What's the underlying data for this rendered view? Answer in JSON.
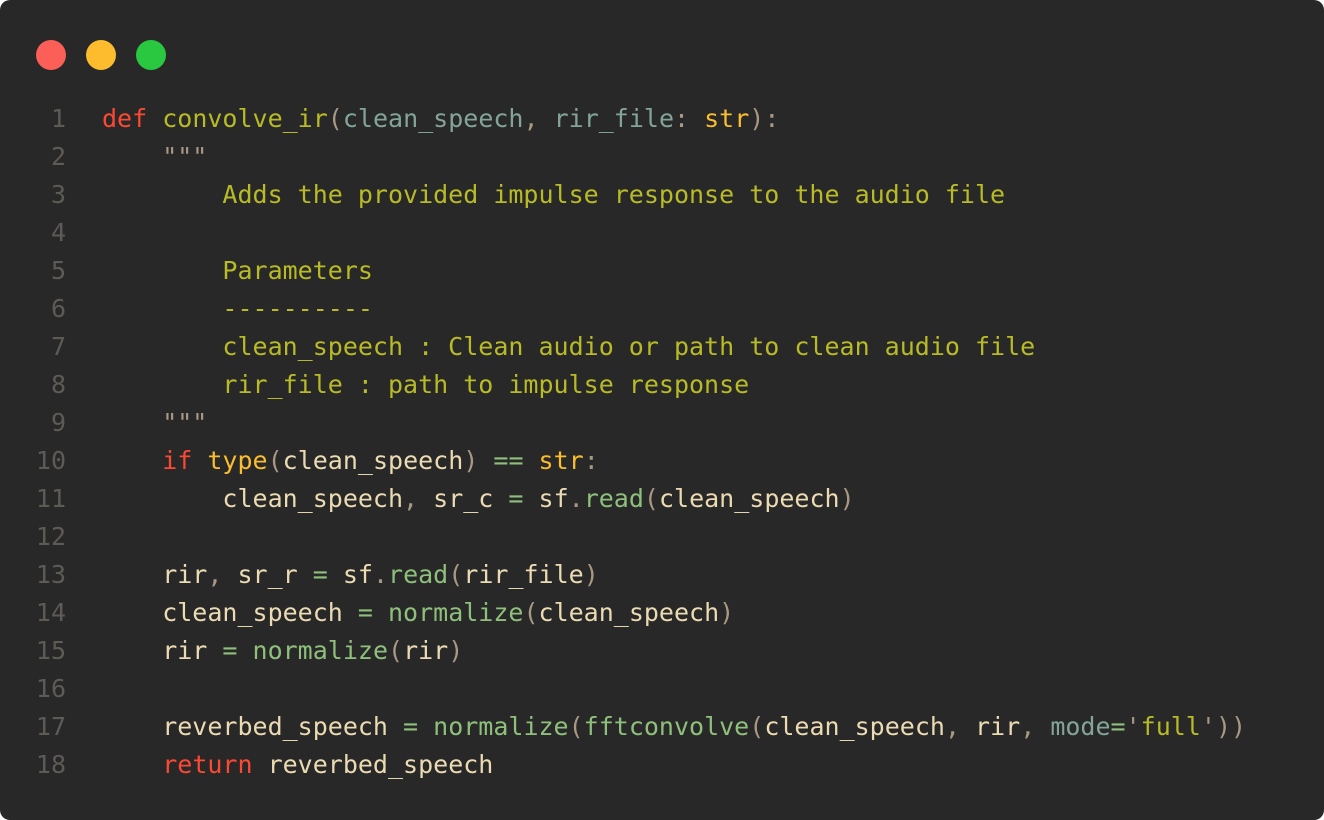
{
  "window": {
    "controls": [
      {
        "name": "close",
        "color": "#fb5f57"
      },
      {
        "name": "minimize",
        "color": "#fdbc2e"
      },
      {
        "name": "maximize",
        "color": "#29c840"
      }
    ]
  },
  "colors": {
    "background": "#282828",
    "line_number": "#5e5a56",
    "keyword": "#fb4934",
    "function_name": "#b8bb26",
    "param": "#83a598",
    "builtin": "#fabd2f",
    "docstring": "#b8bb26",
    "identifier": "#ebdbb2",
    "method": "#8ec07c",
    "punct": "#a89984",
    "string": "#b8bb26",
    "operator": "#8ec07c"
  },
  "lines": [
    {
      "n": "1",
      "tokens": [
        {
          "t": "def ",
          "c": "keyword"
        },
        {
          "t": "convolve_ir",
          "c": "function_name"
        },
        {
          "t": "(",
          "c": "punct"
        },
        {
          "t": "clean_speech",
          "c": "param"
        },
        {
          "t": ", ",
          "c": "punct"
        },
        {
          "t": "rir_file",
          "c": "param"
        },
        {
          "t": ": ",
          "c": "punct"
        },
        {
          "t": "str",
          "c": "builtin"
        },
        {
          "t": "):",
          "c": "punct"
        }
      ]
    },
    {
      "n": "2",
      "tokens": [
        {
          "t": "    \"\"\"",
          "c": "punct"
        }
      ]
    },
    {
      "n": "3",
      "tokens": [
        {
          "t": "        Adds the provided impulse response to the audio file",
          "c": "docstring"
        }
      ]
    },
    {
      "n": "4",
      "tokens": []
    },
    {
      "n": "5",
      "tokens": [
        {
          "t": "        Parameters",
          "c": "docstring"
        }
      ]
    },
    {
      "n": "6",
      "tokens": [
        {
          "t": "        ----------",
          "c": "docstring"
        }
      ]
    },
    {
      "n": "7",
      "tokens": [
        {
          "t": "        clean_speech : Clean audio or path to clean audio file",
          "c": "docstring"
        }
      ]
    },
    {
      "n": "8",
      "tokens": [
        {
          "t": "        rir_file : path to impulse response",
          "c": "docstring"
        }
      ]
    },
    {
      "n": "9",
      "tokens": [
        {
          "t": "    \"\"\"",
          "c": "punct"
        }
      ]
    },
    {
      "n": "10",
      "tokens": [
        {
          "t": "    ",
          "c": "identifier"
        },
        {
          "t": "if ",
          "c": "keyword"
        },
        {
          "t": "type",
          "c": "builtin"
        },
        {
          "t": "(",
          "c": "punct"
        },
        {
          "t": "clean_speech",
          "c": "identifier"
        },
        {
          "t": ") ",
          "c": "punct"
        },
        {
          "t": "== ",
          "c": "operator"
        },
        {
          "t": "str",
          "c": "builtin"
        },
        {
          "t": ":",
          "c": "punct"
        }
      ]
    },
    {
      "n": "11",
      "tokens": [
        {
          "t": "        clean_speech",
          "c": "identifier"
        },
        {
          "t": ", ",
          "c": "punct"
        },
        {
          "t": "sr_c ",
          "c": "identifier"
        },
        {
          "t": "= ",
          "c": "operator"
        },
        {
          "t": "sf",
          "c": "identifier"
        },
        {
          "t": ".",
          "c": "punct"
        },
        {
          "t": "read",
          "c": "method"
        },
        {
          "t": "(",
          "c": "punct"
        },
        {
          "t": "clean_speech",
          "c": "identifier"
        },
        {
          "t": ")",
          "c": "punct"
        }
      ]
    },
    {
      "n": "12",
      "tokens": []
    },
    {
      "n": "13",
      "tokens": [
        {
          "t": "    rir",
          "c": "identifier"
        },
        {
          "t": ", ",
          "c": "punct"
        },
        {
          "t": "sr_r ",
          "c": "identifier"
        },
        {
          "t": "= ",
          "c": "operator"
        },
        {
          "t": "sf",
          "c": "identifier"
        },
        {
          "t": ".",
          "c": "punct"
        },
        {
          "t": "read",
          "c": "method"
        },
        {
          "t": "(",
          "c": "punct"
        },
        {
          "t": "rir_file",
          "c": "identifier"
        },
        {
          "t": ")",
          "c": "punct"
        }
      ]
    },
    {
      "n": "14",
      "tokens": [
        {
          "t": "    clean_speech ",
          "c": "identifier"
        },
        {
          "t": "= ",
          "c": "operator"
        },
        {
          "t": "normalize",
          "c": "method"
        },
        {
          "t": "(",
          "c": "punct"
        },
        {
          "t": "clean_speech",
          "c": "identifier"
        },
        {
          "t": ")",
          "c": "punct"
        }
      ]
    },
    {
      "n": "15",
      "tokens": [
        {
          "t": "    rir ",
          "c": "identifier"
        },
        {
          "t": "= ",
          "c": "operator"
        },
        {
          "t": "normalize",
          "c": "method"
        },
        {
          "t": "(",
          "c": "punct"
        },
        {
          "t": "rir",
          "c": "identifier"
        },
        {
          "t": ")",
          "c": "punct"
        }
      ]
    },
    {
      "n": "16",
      "tokens": []
    },
    {
      "n": "17",
      "tokens": [
        {
          "t": "    reverbed_speech ",
          "c": "identifier"
        },
        {
          "t": "= ",
          "c": "operator"
        },
        {
          "t": "normalize",
          "c": "method"
        },
        {
          "t": "(",
          "c": "punct"
        },
        {
          "t": "fftconvolve",
          "c": "method"
        },
        {
          "t": "(",
          "c": "punct"
        },
        {
          "t": "clean_speech",
          "c": "identifier"
        },
        {
          "t": ", ",
          "c": "punct"
        },
        {
          "t": "rir",
          "c": "identifier"
        },
        {
          "t": ", ",
          "c": "punct"
        },
        {
          "t": "mode",
          "c": "param"
        },
        {
          "t": "=",
          "c": "operator"
        },
        {
          "t": "'",
          "c": "punct"
        },
        {
          "t": "full",
          "c": "string"
        },
        {
          "t": "'",
          "c": "punct"
        },
        {
          "t": "))",
          "c": "punct"
        }
      ]
    },
    {
      "n": "18",
      "tokens": [
        {
          "t": "    ",
          "c": "identifier"
        },
        {
          "t": "return ",
          "c": "keyword"
        },
        {
          "t": "reverbed_speech",
          "c": "identifier"
        }
      ]
    }
  ]
}
